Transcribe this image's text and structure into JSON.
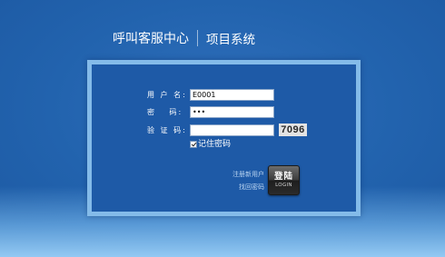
{
  "header": {
    "brand": "呼叫客服中心",
    "system": "项目系统"
  },
  "form": {
    "username": {
      "label": "用 户 名:",
      "value": "E0001"
    },
    "password": {
      "label": "密　 码:",
      "value": "•••"
    },
    "captcha": {
      "label": "验 证 码:",
      "value": "",
      "image_text": "7096"
    },
    "remember": {
      "label": "记住密码",
      "checked": true
    }
  },
  "links": {
    "register": "注册新用户",
    "forgot": "找回密码"
  },
  "login_button": {
    "label": "登陆",
    "sublabel": "LOGIN"
  },
  "colors": {
    "background": "#2263ae",
    "panel": "#1e5aa7",
    "panel_border": "#96cdf5",
    "link": "#b9d4f1"
  }
}
